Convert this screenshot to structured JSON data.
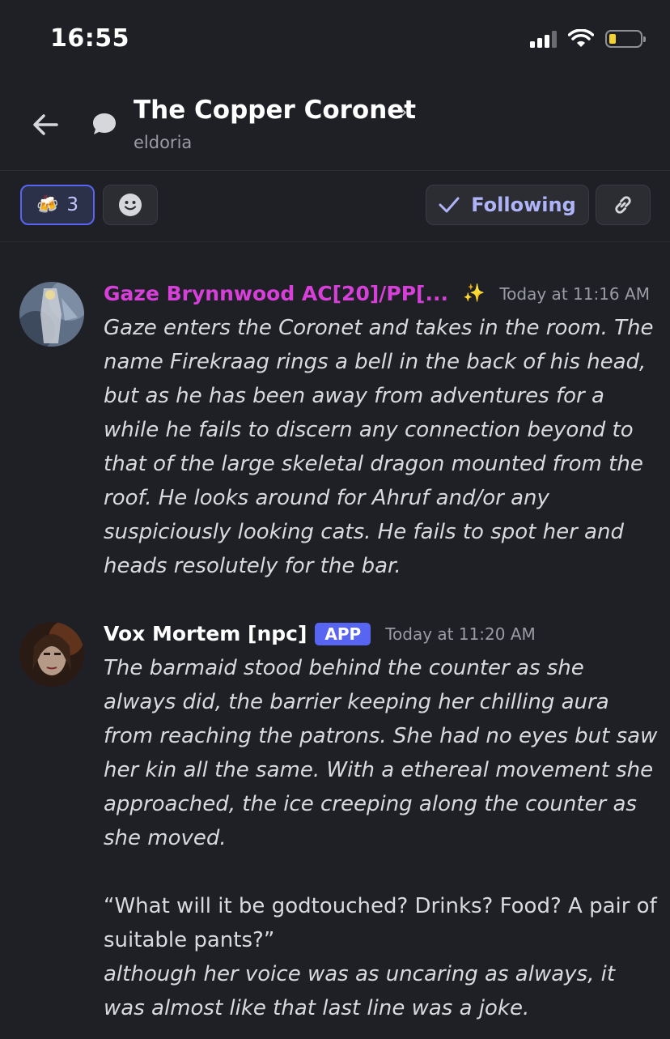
{
  "status_bar": {
    "time": "16:55"
  },
  "header": {
    "title": "The Copper Coronet",
    "title_chevron": "›",
    "subtitle": "eldoria"
  },
  "toolbar": {
    "reaction": {
      "emoji": "🍻",
      "count": "3"
    },
    "follow_label": "Following"
  },
  "messages": [
    {
      "author": "Gaze Brynnwood AC[20]/PP[...",
      "author_color": "#d63fd8",
      "author_icon": "✨",
      "timestamp": "Today at 11:16 AM",
      "text": "Gaze enters the Coronet and takes in the room. The name Firekraag rings a bell in the back of his head, but as he has been away from adventures for a while he fails to discern any connection beyond to that of the large skeletal dragon mounted from the roof. He looks around for Ahruf and/or any suspiciously looking cats. He fails to spot her and heads resolutely for the bar."
    },
    {
      "author": "Vox Mortem [npc]",
      "author_color": "#ffffff",
      "badge": "APP",
      "timestamp": "Today at 11:20 AM",
      "text_1": "The barmaid stood behind the counter as she always did, the barrier keeping her chilling aura from reaching the patrons. She had no eyes but saw her kin all the same. With a ethereal movement she approached, the ice creeping along the counter as she moved.",
      "text_2": "“What will it be godtouched? Drinks? Food? A pair of suitable pants?”",
      "text_3": "although her voice was as uncaring as always, it was almost like that last line was a joke."
    }
  ]
}
